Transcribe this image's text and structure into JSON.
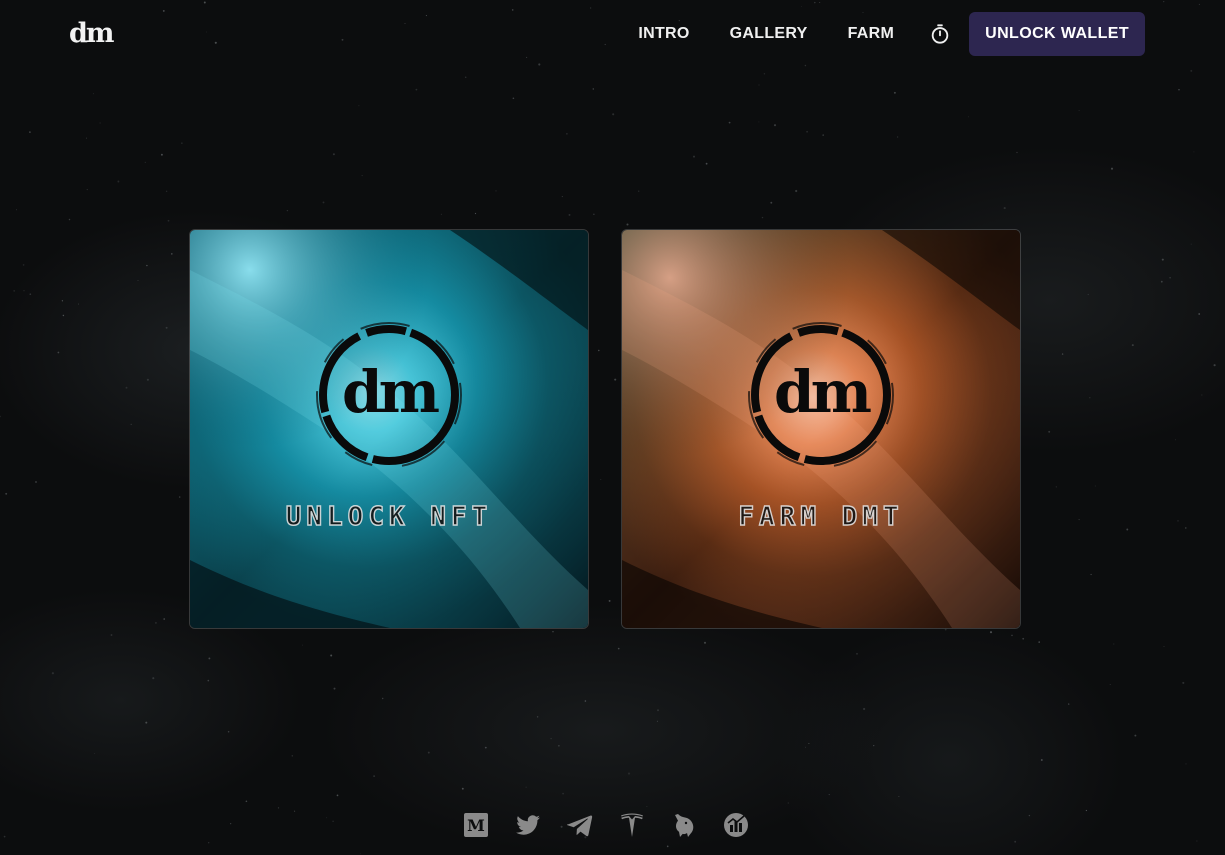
{
  "header": {
    "logo_text": "dm",
    "nav": {
      "intro": "INTRO",
      "gallery": "GALLERY",
      "farm": "FARM"
    },
    "timer_icon": "stopwatch-icon",
    "wallet_button": "UNLOCK WALLET"
  },
  "cards": [
    {
      "logo_text": "dm",
      "label": "UNLOCK NFT",
      "theme": "cyan-nebula"
    },
    {
      "logo_text": "dm",
      "label": "FARM DMT",
      "theme": "orange-nebula"
    }
  ],
  "footer": {
    "social_icons": [
      "medium-icon",
      "twitter-icon",
      "telegram-icon",
      "tesla-icon",
      "unicorn-icon",
      "chart-icon"
    ]
  },
  "colors": {
    "background": "#0c0d0e",
    "wallet_button_bg": "#2d2650",
    "nav_text": "#f0f0f0",
    "icon_gray": "#8a8a8a"
  }
}
